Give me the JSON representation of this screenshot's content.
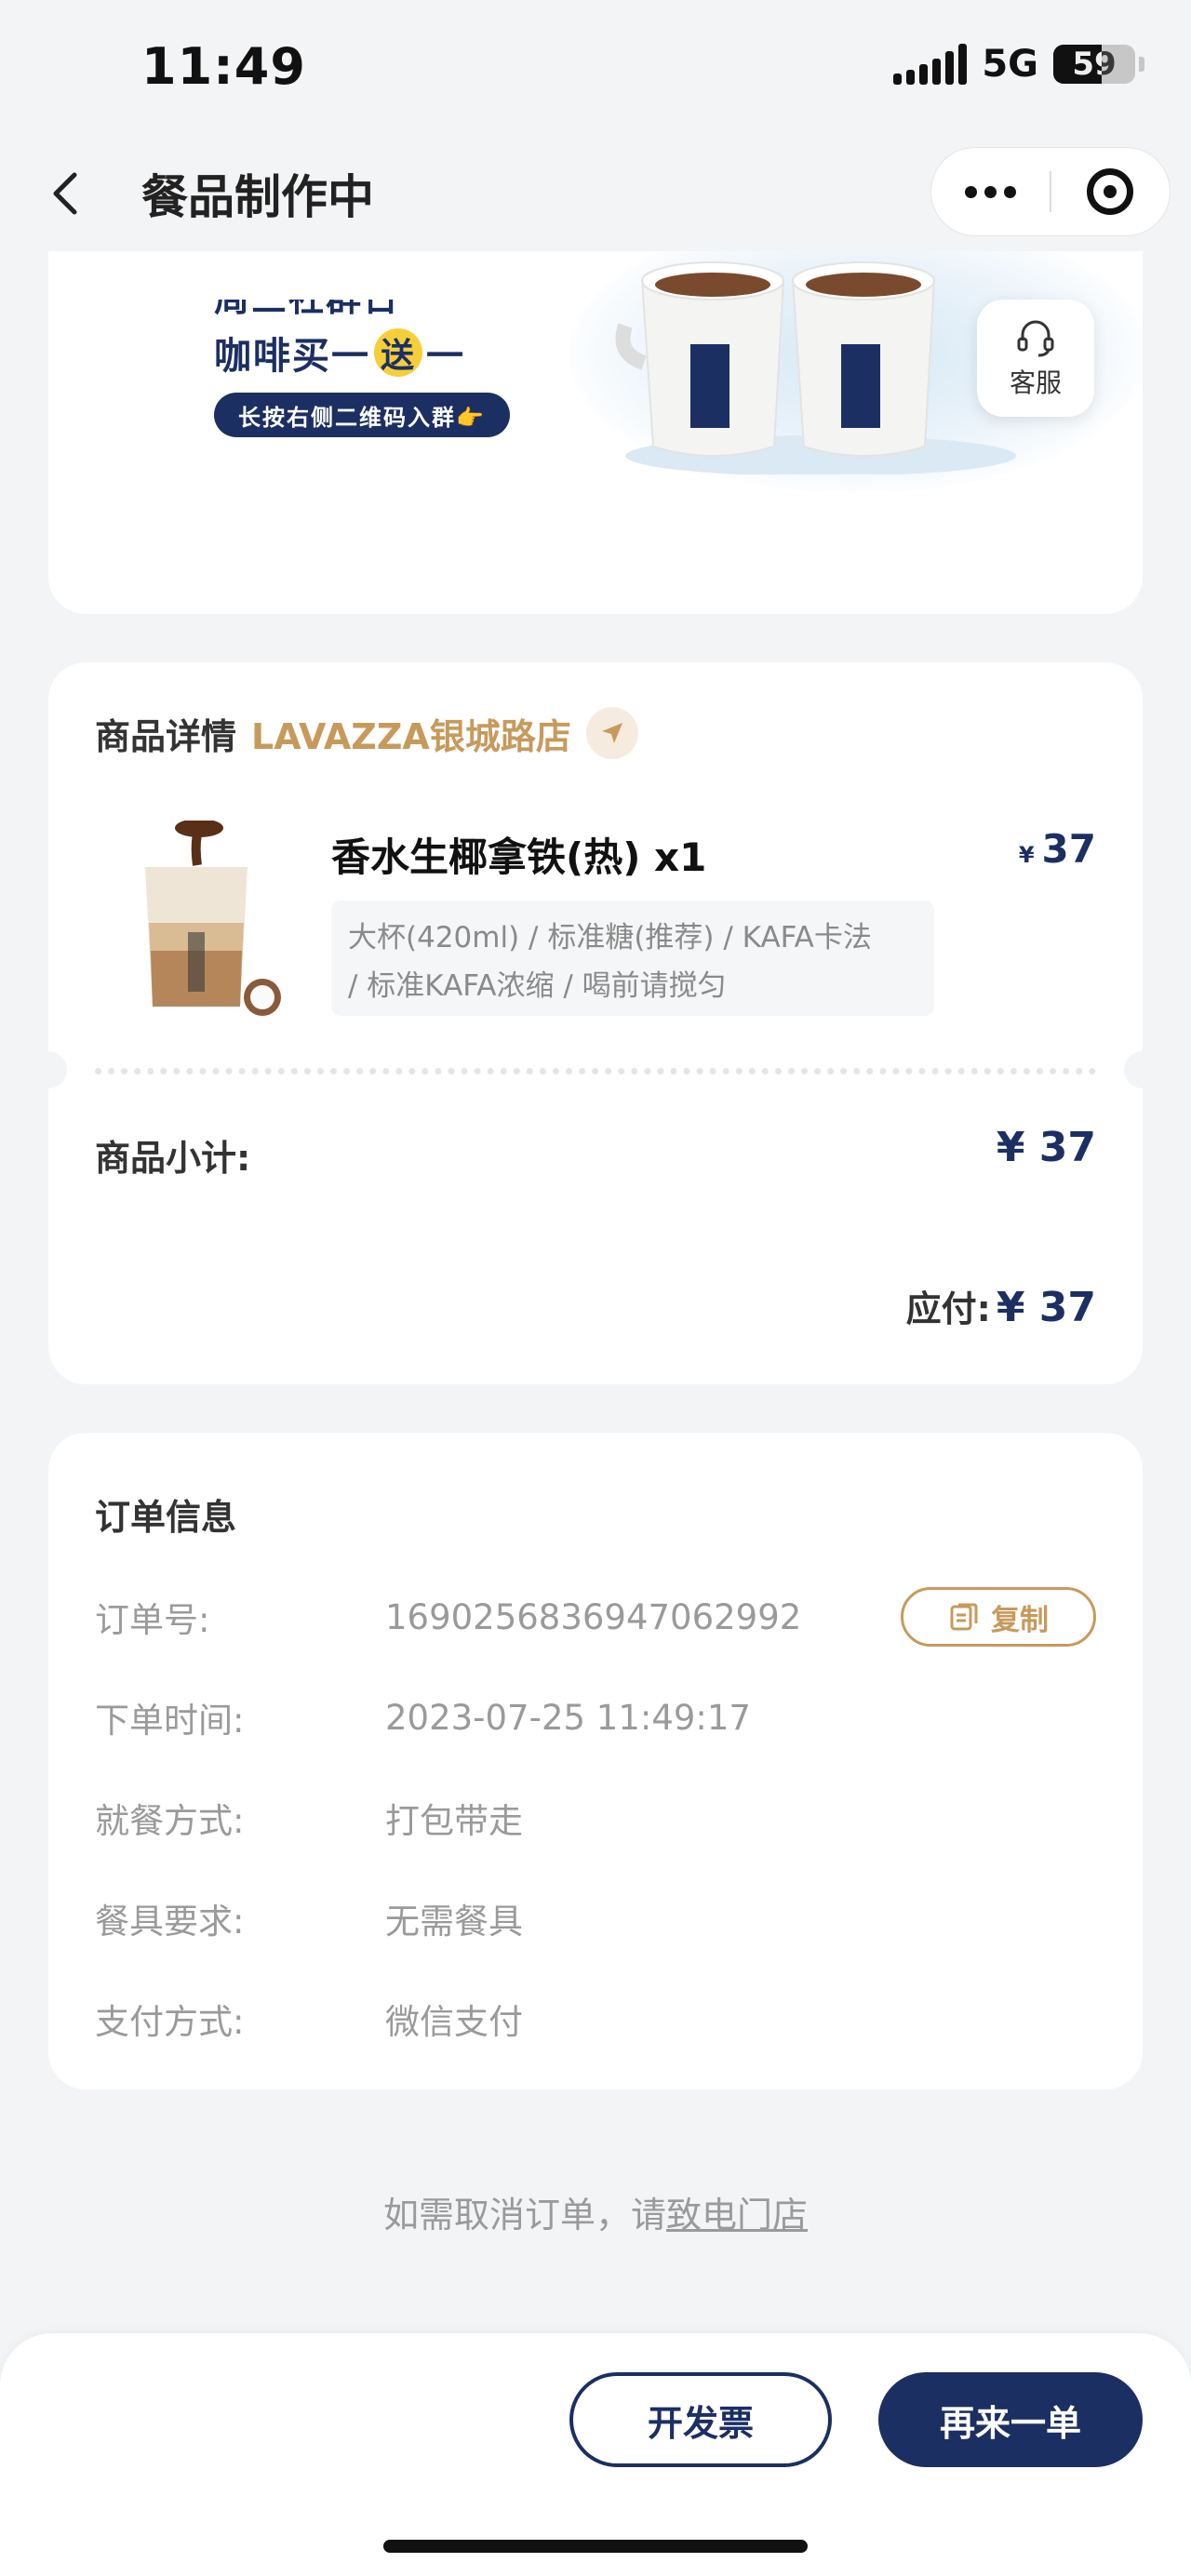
{
  "status_bar": {
    "time": "11:49",
    "network": "5G",
    "battery": "59"
  },
  "nav": {
    "title": "餐品制作中"
  },
  "banner": {
    "line1": "周三社群日",
    "line2_a": "咖啡买一",
    "line2_badge": "送",
    "line2_b": "一",
    "pill": "长按右侧二维码入群👉",
    "service_label": "客服"
  },
  "product_detail": {
    "title": "商品详情",
    "store": "LAVAZZA银城路店",
    "item": {
      "name": "香水生椰拿铁(热) x1",
      "currency": "¥",
      "price": "37",
      "specs_line1": "大杯(420ml) / 标准糖(推荐) / KAFA卡法",
      "specs_line2": "/ 标准KAFA浓缩 / 喝前请搅匀"
    },
    "subtotal_label": "商品小计:",
    "subtotal_value": "¥ 37",
    "payable_label": "应付:",
    "payable_value": "¥ 37"
  },
  "order_info": {
    "title": "订单信息",
    "rows": [
      {
        "label": "订单号:",
        "value": "1690256836947062992"
      },
      {
        "label": "下单时间:",
        "value": "2023-07-25 11:49:17"
      },
      {
        "label": "就餐方式:",
        "value": "打包带走"
      },
      {
        "label": "餐具要求:",
        "value": "无需餐具"
      },
      {
        "label": "支付方式:",
        "value": "微信支付"
      }
    ],
    "copy_label": "复制"
  },
  "cancel_note": {
    "text": "如需取消订单，请",
    "link": "致电门店"
  },
  "actions": {
    "invoice": "开发票",
    "reorder": "再来一单"
  },
  "colors": {
    "navy": "#1c2f63",
    "gold": "#c79a5c",
    "background": "#f3f4f6"
  }
}
